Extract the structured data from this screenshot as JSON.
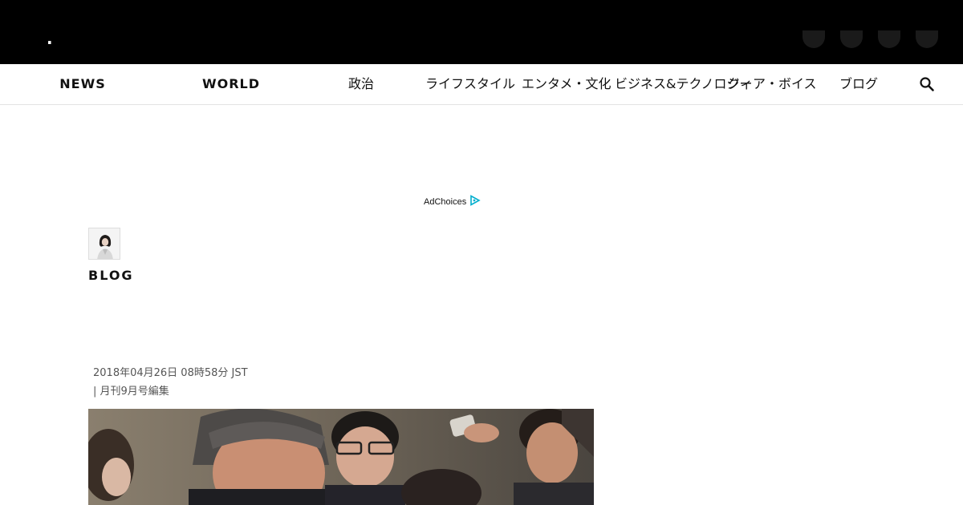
{
  "header": {
    "logo_fragment": "."
  },
  "nav": {
    "items": [
      {
        "label": "NEWS"
      },
      {
        "label": "WORLD"
      },
      {
        "label": "政治"
      },
      {
        "label": "ライフスタイル"
      },
      {
        "label": "エンタメ・文化"
      },
      {
        "label": "ビジネス&テクノロジー"
      },
      {
        "label": "クィア・ボイス"
      },
      {
        "label": "ブログ"
      }
    ]
  },
  "ad": {
    "label": "AdChoices"
  },
  "blog": {
    "label": "BLOG"
  },
  "article": {
    "date": "2018年04月26日 08時58分 JST",
    "author": "| 月刊9月号編集"
  },
  "colors": {
    "topbar": "#000000",
    "adchoices_accent": "#00aecd"
  },
  "icons": {
    "search": "search-icon",
    "adchoices": "adchoices-icon"
  }
}
